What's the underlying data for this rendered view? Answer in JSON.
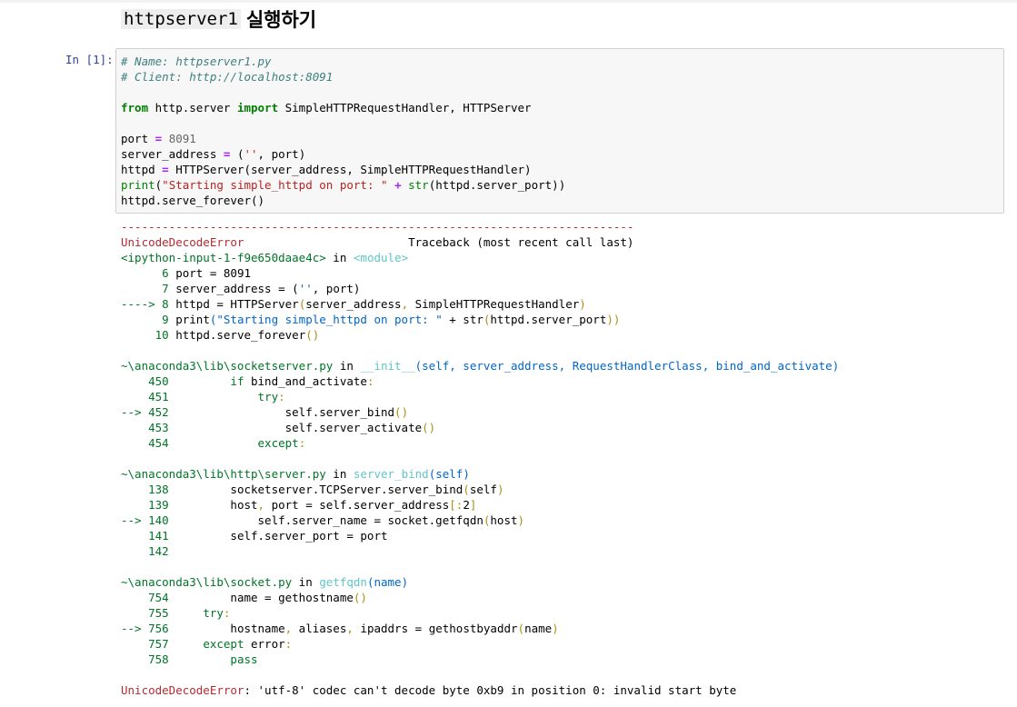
{
  "heading": {
    "code": "httpserver1",
    "text": "실행하기"
  },
  "cell": {
    "prompt": "In [1]:",
    "source": [
      [
        {
          "t": "# Name: httpserver1.py",
          "c": "cm"
        }
      ],
      [
        {
          "t": "# Client: http://localhost:8091",
          "c": "cm"
        }
      ],
      [],
      [
        {
          "t": "from",
          "c": "kw"
        },
        {
          "t": " http.server "
        },
        {
          "t": "import",
          "c": "kw"
        },
        {
          "t": " SimpleHTTPRequestHandler, HTTPServer"
        }
      ],
      [],
      [
        {
          "t": "port "
        },
        {
          "t": "=",
          "c": "op"
        },
        {
          "t": " "
        },
        {
          "t": "8091",
          "c": "num"
        }
      ],
      [
        {
          "t": "server_address "
        },
        {
          "t": "=",
          "c": "op"
        },
        {
          "t": " ("
        },
        {
          "t": "''",
          "c": "str"
        },
        {
          "t": ", port)"
        }
      ],
      [
        {
          "t": "httpd "
        },
        {
          "t": "=",
          "c": "op"
        },
        {
          "t": " HTTPServer(server_address, SimpleHTTPRequestHandler)"
        }
      ],
      [
        {
          "t": "print",
          "c": "bi"
        },
        {
          "t": "("
        },
        {
          "t": "\"Starting simple_httpd on port: \"",
          "c": "str"
        },
        {
          "t": " "
        },
        {
          "t": "+",
          "c": "op"
        },
        {
          "t": " "
        },
        {
          "t": "str",
          "c": "bi"
        },
        {
          "t": "(httpd.server_port))"
        }
      ],
      [
        {
          "t": "httpd.serve_forever()"
        }
      ]
    ]
  },
  "traceback": [
    [
      {
        "t": "---------------------------------------------------------------------------",
        "c": "red"
      }
    ],
    [
      {
        "t": "UnicodeDecodeError",
        "c": "red"
      },
      {
        "t": "                        Traceback (most recent call last)"
      }
    ],
    [
      {
        "t": "<ipython-input-1-f9e650daae4c>",
        "c": "grn"
      },
      {
        "t": " in "
      },
      {
        "t": "<module>",
        "c": "cyn"
      }
    ],
    [
      {
        "t": "      6",
        "c": "grn"
      },
      {
        "t": " port = 8091"
      }
    ],
    [
      {
        "t": "      7",
        "c": "grn"
      },
      {
        "t": " server_address = ("
      },
      {
        "t": "''",
        "c": "blu"
      },
      {
        "t": ", port)"
      }
    ],
    [
      {
        "t": "----> 8",
        "c": "grn"
      },
      {
        "t": " httpd = HTTPServer"
      },
      {
        "t": "(",
        "c": "gld"
      },
      {
        "t": "server_address"
      },
      {
        "t": ",",
        "c": "gld"
      },
      {
        "t": " SimpleHTTPRequestHandler"
      },
      {
        "t": ")",
        "c": "gld"
      }
    ],
    [
      {
        "t": "      9",
        "c": "grn"
      },
      {
        "t": " print"
      },
      {
        "t": "(\"Starting simple_httpd on port: \"",
        "c": "blu"
      },
      {
        "t": " + str"
      },
      {
        "t": "(",
        "c": "gld"
      },
      {
        "t": "httpd.server_port"
      },
      {
        "t": "))",
        "c": "gld"
      }
    ],
    [
      {
        "t": "     10",
        "c": "grn"
      },
      {
        "t": " httpd.serve_forever"
      },
      {
        "t": "()",
        "c": "gld"
      }
    ],
    [],
    [
      {
        "t": "~\\anaconda3\\lib\\socketserver.py",
        "c": "grn"
      },
      {
        "t": " in "
      },
      {
        "t": "__init__",
        "c": "cyn"
      },
      {
        "t": "(self, server_address, RequestHandlerClass, bind_and_activate)",
        "c": "blu"
      }
    ],
    [
      {
        "t": "    450",
        "c": "grn"
      },
      {
        "t": "         "
      },
      {
        "t": "if",
        "c": "grn"
      },
      {
        "t": " bind_and_activate"
      },
      {
        "t": ":",
        "c": "gld"
      }
    ],
    [
      {
        "t": "    451",
        "c": "grn"
      },
      {
        "t": "             "
      },
      {
        "t": "try",
        "c": "grn"
      },
      {
        "t": ":",
        "c": "gld"
      }
    ],
    [
      {
        "t": "--> 452",
        "c": "grn"
      },
      {
        "t": "                 self.server_bind"
      },
      {
        "t": "()",
        "c": "gld"
      }
    ],
    [
      {
        "t": "    453",
        "c": "grn"
      },
      {
        "t": "                 self.server_activate"
      },
      {
        "t": "()",
        "c": "gld"
      }
    ],
    [
      {
        "t": "    454",
        "c": "grn"
      },
      {
        "t": "             "
      },
      {
        "t": "except",
        "c": "grn"
      },
      {
        "t": ":",
        "c": "gld"
      }
    ],
    [],
    [
      {
        "t": "~\\anaconda3\\lib\\http\\server.py",
        "c": "grn"
      },
      {
        "t": " in "
      },
      {
        "t": "server_bind",
        "c": "cyn"
      },
      {
        "t": "(self)",
        "c": "blu"
      }
    ],
    [
      {
        "t": "    138",
        "c": "grn"
      },
      {
        "t": "         socketserver.TCPServer.server_bind"
      },
      {
        "t": "(",
        "c": "gld"
      },
      {
        "t": "self"
      },
      {
        "t": ")",
        "c": "gld"
      }
    ],
    [
      {
        "t": "    139",
        "c": "grn"
      },
      {
        "t": "         host"
      },
      {
        "t": ",",
        "c": "gld"
      },
      {
        "t": " port = self.server_address"
      },
      {
        "t": "[:",
        "c": "gld"
      },
      {
        "t": "2"
      },
      {
        "t": "]",
        "c": "gld"
      }
    ],
    [
      {
        "t": "--> 140",
        "c": "grn"
      },
      {
        "t": "             self.server_name = socket.getfqdn"
      },
      {
        "t": "(",
        "c": "gld"
      },
      {
        "t": "host"
      },
      {
        "t": ")",
        "c": "gld"
      }
    ],
    [
      {
        "t": "    141",
        "c": "grn"
      },
      {
        "t": "         self.server_port = port"
      }
    ],
    [
      {
        "t": "    142",
        "c": "grn"
      }
    ],
    [],
    [
      {
        "t": "~\\anaconda3\\lib\\socket.py",
        "c": "grn"
      },
      {
        "t": " in "
      },
      {
        "t": "getfqdn",
        "c": "cyn"
      },
      {
        "t": "(name)",
        "c": "blu"
      }
    ],
    [
      {
        "t": "    754",
        "c": "grn"
      },
      {
        "t": "         name = gethostname"
      },
      {
        "t": "()",
        "c": "gld"
      }
    ],
    [
      {
        "t": "    755",
        "c": "grn"
      },
      {
        "t": "     "
      },
      {
        "t": "try",
        "c": "grn"
      },
      {
        "t": ":",
        "c": "gld"
      }
    ],
    [
      {
        "t": "--> 756",
        "c": "grn"
      },
      {
        "t": "         hostname"
      },
      {
        "t": ",",
        "c": "gld"
      },
      {
        "t": " aliases"
      },
      {
        "t": ",",
        "c": "gld"
      },
      {
        "t": " ipaddrs = gethostbyaddr"
      },
      {
        "t": "(",
        "c": "gld"
      },
      {
        "t": "name"
      },
      {
        "t": ")",
        "c": "gld"
      }
    ],
    [
      {
        "t": "    757",
        "c": "grn"
      },
      {
        "t": "     "
      },
      {
        "t": "except",
        "c": "grn"
      },
      {
        "t": " error"
      },
      {
        "t": ":",
        "c": "gld"
      }
    ],
    [
      {
        "t": "    758",
        "c": "grn"
      },
      {
        "t": "         "
      },
      {
        "t": "pass",
        "c": "grn"
      }
    ],
    [],
    [
      {
        "t": "UnicodeDecodeError",
        "c": "red"
      },
      {
        "t": ": 'utf-8' codec can't decode byte 0xb9 in position 0: invalid start byte"
      }
    ]
  ]
}
